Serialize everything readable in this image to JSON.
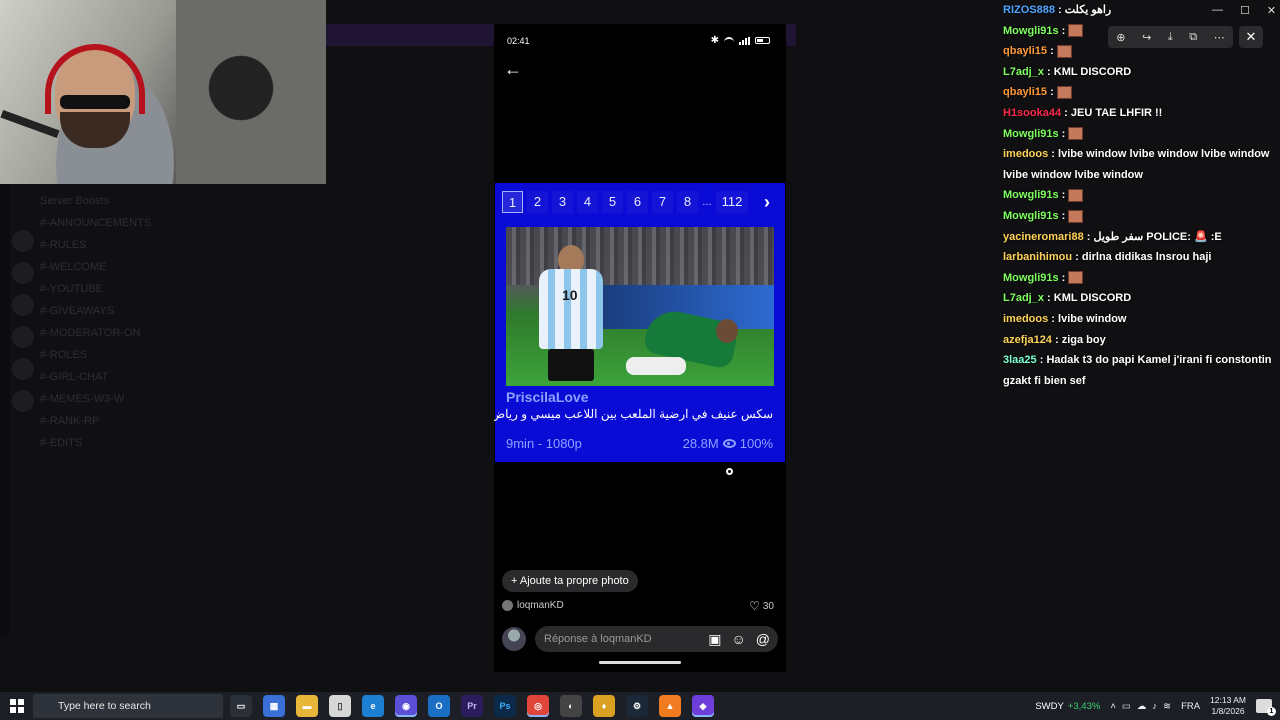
{
  "phone": {
    "status_time": "02:41",
    "back_icon": "arrow-left-icon",
    "ad": {
      "pages": [
        "1",
        "2",
        "3",
        "4",
        "5",
        "6",
        "7",
        "8"
      ],
      "active_page": "1",
      "ellipsis": "...",
      "last_page": "112",
      "next_icon": "chevron-right-icon",
      "name": "PriscilaLove",
      "title": "سكس عنيف في ارضية الملعب بين اللاعب ميسي و رياض محرز",
      "duration_quality": "9min - 1080p",
      "views": "28.8M",
      "rating": "100%",
      "thumb_jersey_number": "10"
    },
    "add_photo_label": "+ Ajoute ta propre photo",
    "author": "loqmanKD",
    "likes": "30",
    "reply_placeholder": "Réponse à loqmanKD"
  },
  "chat": [
    {
      "user": "RIZOS888",
      "color": "#4da6ff",
      "text": "راهو يكلت"
    },
    {
      "user": "Mowgli91s",
      "color": "#7fff5f",
      "text": "",
      "emote": true
    },
    {
      "user": "qbayli15",
      "color": "#ff9a3c",
      "text": "",
      "emote": true
    },
    {
      "user": "L7adj_x",
      "color": "#7fff5f",
      "text": "KML DISCORD"
    },
    {
      "user": "qbayli15",
      "color": "#ff9a3c",
      "text": "",
      "emote": true
    },
    {
      "user": "H1sooka44",
      "color": "#ff2a4a",
      "text": "JEU TAE LHFIR !!"
    },
    {
      "user": "Mowgli91s",
      "color": "#7fff5f",
      "text": "",
      "emote": true
    },
    {
      "user": "imedoos",
      "color": "#ffd35a",
      "text": "lvibe window lvibe window lvibe window lvibe window lvibe window"
    },
    {
      "user": "Mowgli91s",
      "color": "#7fff5f",
      "text": "",
      "emote": true
    },
    {
      "user": "Mowgli91s",
      "color": "#7fff5f",
      "text": "",
      "emote": true
    },
    {
      "user": "yacineromari88",
      "color": "#ffd35a",
      "text": "سفر طويل POLICE: 🚨 :E"
    },
    {
      "user": "larbanihimou",
      "color": "#ffd35a",
      "text": "dirlna didikas lnsrou haji"
    },
    {
      "user": "Mowgli91s",
      "color": "#7fff5f",
      "text": "",
      "emote": true
    },
    {
      "user": "L7adj_x",
      "color": "#7fff5f",
      "text": "KML DISCORD"
    },
    {
      "user": "imedoos",
      "color": "#ffd35a",
      "text": "lvibe window"
    },
    {
      "user": "azefja124",
      "color": "#ffd35a",
      "text": "ziga boy"
    },
    {
      "user": "3laa25",
      "color": "#7fffd4",
      "text": "Hadak t3 do papi Kamel j'irani fi constontin gzakt fi bien sef"
    }
  ],
  "taskbar": {
    "search_placeholder": "Type here to search",
    "stock_name": "SWDY",
    "stock_change": "+3,43%",
    "language": "FRA",
    "time": "12:13 AM",
    "date": "1/8/2026",
    "notification_count": "1"
  },
  "background": {
    "channels": [
      "Server Boosts",
      "#-ANNOUNCEMENTS",
      "#-RULES",
      "#-WELCOME",
      "#-YOUTUBE",
      "#-GIVEAWAYS",
      "#-MODERATOR-ON",
      "#-ROLES",
      "#-GIRL-CHAT",
      "#-MEMES-W3-W",
      "#-RANK-RP",
      "#-EDITS"
    ]
  },
  "colors": {
    "ad_background": "#0b0bd6",
    "ad_text": "#8aa2ff",
    "taskbar": "#1c1f26"
  }
}
